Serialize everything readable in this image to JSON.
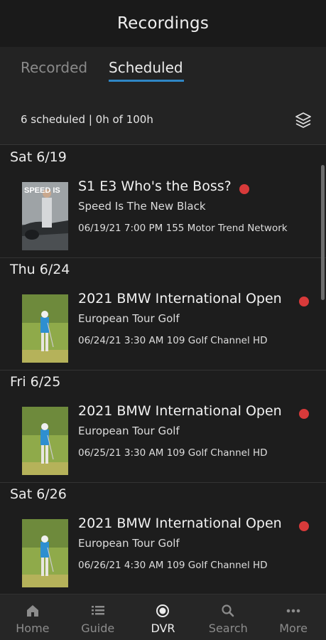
{
  "header": {
    "title": "Recordings"
  },
  "tabs": [
    {
      "label": "Recorded",
      "active": false
    },
    {
      "label": "Scheduled",
      "active": true
    }
  ],
  "summary": {
    "text": "6 scheduled | 0h of 100h",
    "icon": "layers-icon"
  },
  "groups": [
    {
      "date": "Sat 6/19",
      "item": {
        "title": "S1 E3 Who's the Boss?",
        "subtitle": "Speed Is The New Black",
        "meta": "06/19/21 7:00 PM 155 Motor Trend Network",
        "thumb_text": "SPEED IS"
      }
    },
    {
      "date": "Thu 6/24",
      "item": {
        "title": "2021 BMW International Open",
        "subtitle": "European Tour Golf",
        "meta": "06/24/21 3:30 AM 109 Golf Channel HD"
      }
    },
    {
      "date": "Fri 6/25",
      "item": {
        "title": "2021 BMW International Open",
        "subtitle": "European Tour Golf",
        "meta": "06/25/21 3:30 AM 109 Golf Channel HD"
      }
    },
    {
      "date": "Sat 6/26",
      "item": {
        "title": "2021 BMW International Open",
        "subtitle": "European Tour Golf",
        "meta": "06/26/21 4:30 AM 109 Golf Channel HD"
      }
    }
  ],
  "nav": [
    {
      "label": "Home",
      "icon": "home-icon",
      "active": false
    },
    {
      "label": "Guide",
      "icon": "guide-icon",
      "active": false
    },
    {
      "label": "DVR",
      "icon": "dvr-icon",
      "active": true
    },
    {
      "label": "Search",
      "icon": "search-icon",
      "active": false
    },
    {
      "label": "More",
      "icon": "more-icon",
      "active": false
    }
  ],
  "colors": {
    "accent": "#2f86c5",
    "record_dot": "#d83a3a",
    "background": "#1a1a1a"
  }
}
